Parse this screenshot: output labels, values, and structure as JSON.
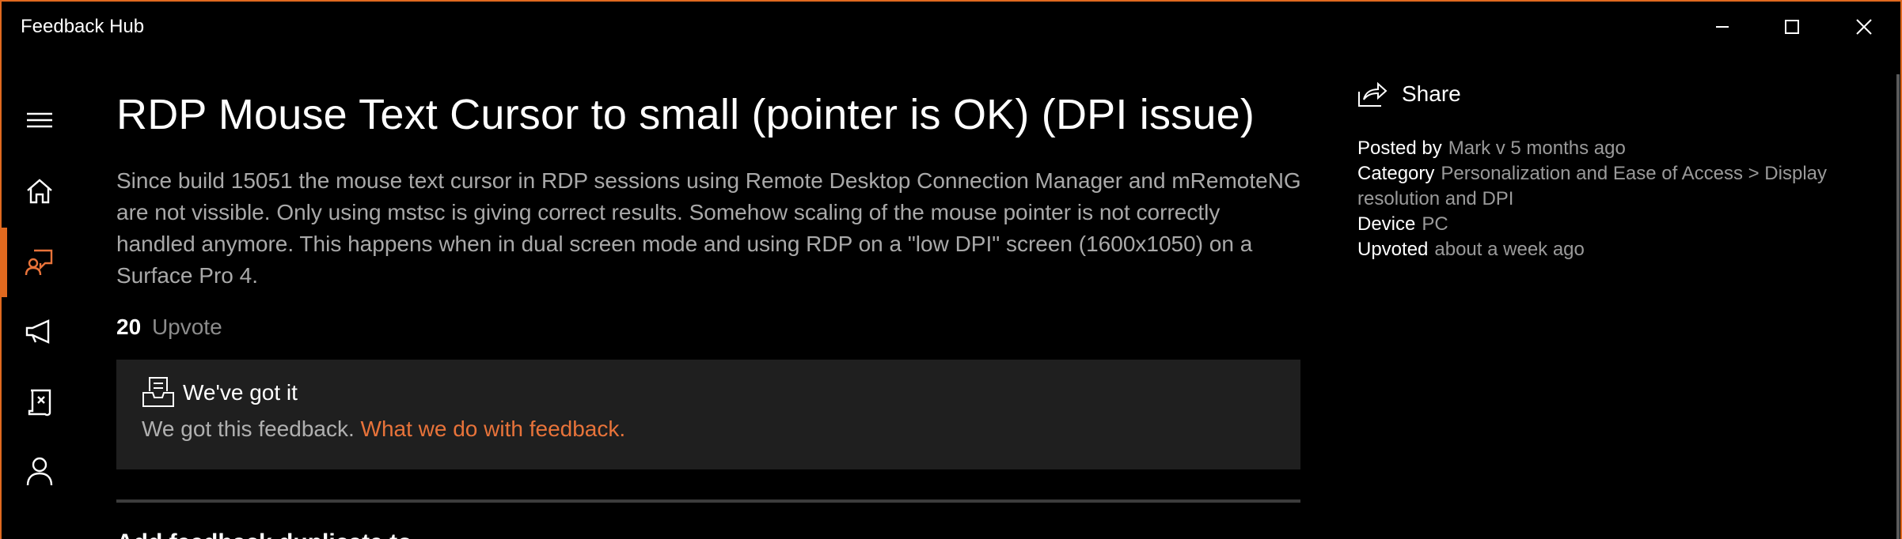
{
  "app": {
    "title": "Feedback Hub"
  },
  "sidebar": {
    "items": [
      {
        "name": "menu",
        "icon": "hamburger-icon"
      },
      {
        "name": "home",
        "icon": "home-icon"
      },
      {
        "name": "feedback",
        "icon": "feedback-icon",
        "active": true
      },
      {
        "name": "announcements",
        "icon": "megaphone-icon"
      },
      {
        "name": "quests",
        "icon": "quests-icon"
      },
      {
        "name": "profile",
        "icon": "person-icon"
      }
    ]
  },
  "feedback": {
    "title": "RDP Mouse Text Cursor to small (pointer is OK) (DPI issue)",
    "description": "Since build 15051 the mouse text cursor in RDP sessions using Remote Desktop Connection Manager and mRemoteNG are not vissible. Only using mstsc is giving correct results. Somehow scaling of the mouse pointer is not correctly handled anymore. This happens when in dual screen mode and using RDP on a \"low DPI\" screen (1600x1050) on a Surface Pro 4.",
    "upvote_count": "20",
    "upvote_label": "Upvote",
    "status": {
      "title": "We've got it",
      "text": "We got this feedback.",
      "link": "What we do with feedback."
    },
    "next_heading": "Add feedback duplicate to..."
  },
  "side": {
    "share_label": "Share",
    "posted_by_key": "Posted by",
    "posted_by_value": "Mark v 5 months ago",
    "category_key": "Category",
    "category_value": "Personalization and Ease of Access > Display resolution and DPI",
    "device_key": "Device",
    "device_value": "PC",
    "upvoted_key": "Upvoted",
    "upvoted_value": "about a week ago"
  },
  "colors": {
    "accent": "#e0691f",
    "background": "#000000",
    "panel": "#1f1f1f"
  }
}
